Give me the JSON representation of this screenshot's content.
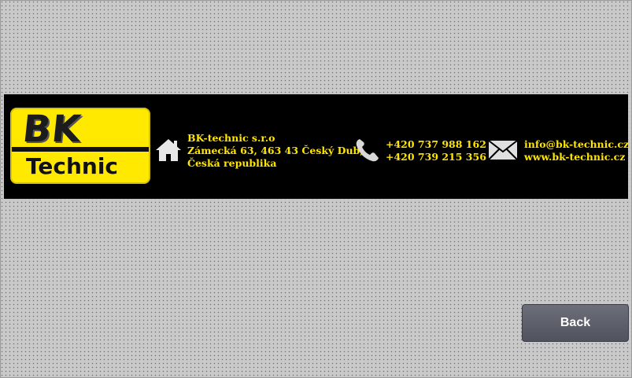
{
  "banner": {
    "logo": {
      "top": "BK",
      "bottom": "Technic"
    },
    "address": {
      "icon": "home-icon",
      "line1": "BK-technic s.r.o",
      "line2": "Zámecká 63, 463 43 Český Dub,",
      "line3": "Česká republika"
    },
    "phone": {
      "icon": "phone-icon",
      "line1": "+420 737 988 162",
      "line2": "+420 739 215 356"
    },
    "contact": {
      "icon": "envelope-icon",
      "email": "info@bk-technic.cz",
      "web": "www.bk-technic.cz"
    },
    "text_color": "#ffe500",
    "logo_color": "#ffe900"
  },
  "back_button": {
    "label": "Back"
  }
}
